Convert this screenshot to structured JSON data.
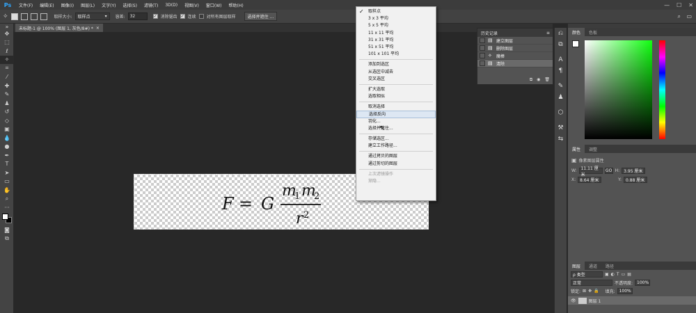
{
  "menubar": {
    "logo": "Ps",
    "items": [
      "文件(F)",
      "编辑(E)",
      "图像(I)",
      "图层(L)",
      "文字(Y)",
      "选择(S)",
      "滤镜(T)",
      "3D(D)",
      "视图(V)",
      "窗口(W)",
      "帮助(H)"
    ]
  },
  "optbar": {
    "sample_size_label": "取样大小:",
    "sample_size_value": "取样点",
    "tolerance_label": "容差:",
    "tolerance_value": "32",
    "antialias_label": "消除锯齿",
    "contiguous_label": "连续",
    "all_layers_label": "对所有图层取样",
    "select_mask_button": "选择并遮住 ..."
  },
  "document": {
    "tab_title": "未标题-1 @ 100% (图层 1, 灰色/8#) *",
    "formula": "F = G m₁m₂ / r²"
  },
  "dropdown": {
    "items": [
      {
        "label": "取样点",
        "checked": true
      },
      {
        "label": "3 x 3 平均"
      },
      {
        "label": "5 x 5 平均"
      },
      {
        "label": "11 x 11 平均"
      },
      {
        "label": "31 x 31 平均"
      },
      {
        "label": "51 x 51 平均"
      },
      {
        "label": "101 x 101 平均"
      },
      {
        "sep": true
      },
      {
        "label": "添加到选区"
      },
      {
        "label": "从选区中减去"
      },
      {
        "label": "交叉选区"
      },
      {
        "sep": true
      },
      {
        "label": "扩大选取"
      },
      {
        "label": "选取相似"
      },
      {
        "sep": true
      },
      {
        "label": "取消选择"
      },
      {
        "label": "选择反向",
        "selected": true
      },
      {
        "label": "羽化..."
      },
      {
        "label": "选择并遮住..."
      },
      {
        "sep": true
      },
      {
        "label": "存储选区..."
      },
      {
        "label": "建立工作路径..."
      },
      {
        "sep": true
      },
      {
        "label": "通过拷贝的图层"
      },
      {
        "label": "通过剪切的图层"
      },
      {
        "sep": true
      },
      {
        "label": "上次滤镜操作",
        "disabled": true
      },
      {
        "label": "渐隐...",
        "disabled": true
      }
    ]
  },
  "history": {
    "title": "历史记录",
    "items": [
      {
        "label": "建立图层"
      },
      {
        "label": "删除图层"
      },
      {
        "label": "魔棒"
      },
      {
        "label": "清除",
        "current": true
      }
    ]
  },
  "color_panel": {
    "tabs": [
      "颜色",
      "色板"
    ]
  },
  "properties": {
    "tabs": [
      "属性",
      "调整"
    ],
    "section": "像素图层属性",
    "w_label": "W:",
    "w_value": "11.11 厘米",
    "h_label": "H:",
    "h_value": "3.95 厘米",
    "x_label": "X:",
    "x_value": "8.64 厘米",
    "y_label": "Y:",
    "y_value": "0.88 厘米",
    "link_label": "GO"
  },
  "layers": {
    "tabs": [
      "图层",
      "通道",
      "路径"
    ],
    "kind_label": "ρ 类型",
    "blend_mode": "正常",
    "opacity_label": "不透明度:",
    "opacity_value": "100%",
    "lock_label": "锁定:",
    "fill_label": "填充:",
    "fill_value": "100%",
    "layer_name": "图层 1"
  }
}
